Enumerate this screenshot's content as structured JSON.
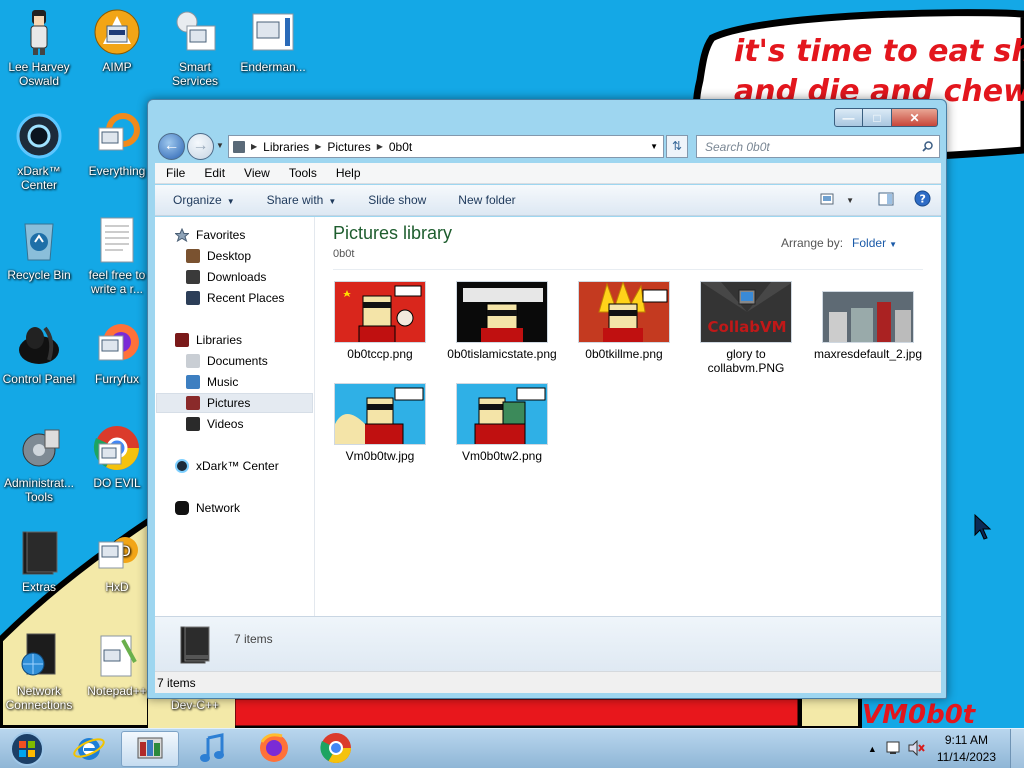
{
  "wallpaper": {
    "banner_text_line1": "it's time to eat shit",
    "banner_text_line2": "and die and chew",
    "signature": "VM0b0t"
  },
  "desktop_icons": [
    {
      "label": "Lee Harvey Oswald"
    },
    {
      "label": "AIMP"
    },
    {
      "label": "Smart Services"
    },
    {
      "label": "Enderman..."
    },
    {
      "label": "xDark™ Center"
    },
    {
      "label": "Everything"
    },
    {
      "label": "Recycle Bin"
    },
    {
      "label": "feel free to write a r..."
    },
    {
      "label": "Control Panel"
    },
    {
      "label": "Furryfux"
    },
    {
      "label": "Administrat... Tools"
    },
    {
      "label": "DO EVIL"
    },
    {
      "label": "Extras"
    },
    {
      "label": "HxD"
    },
    {
      "label": "Network Connections"
    },
    {
      "label": "Notepad++"
    },
    {
      "label": "Dev-C++"
    }
  ],
  "explorer": {
    "address_segments": [
      "Libraries",
      "Pictures",
      "0b0t"
    ],
    "search_placeholder": "Search 0b0t",
    "menu": [
      "File",
      "Edit",
      "View",
      "Tools",
      "Help"
    ],
    "commands": {
      "organize": "Organize",
      "share_with": "Share with",
      "slide_show": "Slide show",
      "new_folder": "New folder"
    },
    "nav": {
      "favorites": "Favorites",
      "desktop": "Desktop",
      "downloads": "Downloads",
      "recent_places": "Recent Places",
      "libraries": "Libraries",
      "documents": "Documents",
      "music": "Music",
      "pictures": "Pictures",
      "videos": "Videos",
      "xdark_center": "xDark™ Center",
      "network": "Network"
    },
    "library_title": "Pictures library",
    "library_subtitle": "0b0t",
    "arrange_by_label": "Arrange by:",
    "arrange_by_value": "Folder",
    "files": [
      {
        "name": "0b0tccp.png"
      },
      {
        "name": "0b0tislamicstate.png"
      },
      {
        "name": "0b0tkillme.png"
      },
      {
        "name": "glory to collabvm.PNG",
        "image_text": "CollabVM"
      },
      {
        "name": "maxresdefault_2.jpg"
      },
      {
        "name": "Vm0b0tw.jpg"
      },
      {
        "name": "Vm0b0tw2.png"
      }
    ],
    "details_count": "7 items",
    "status_count": "7 items"
  },
  "taskbar": {
    "time": "9:11 AM",
    "date": "11/14/2023"
  }
}
